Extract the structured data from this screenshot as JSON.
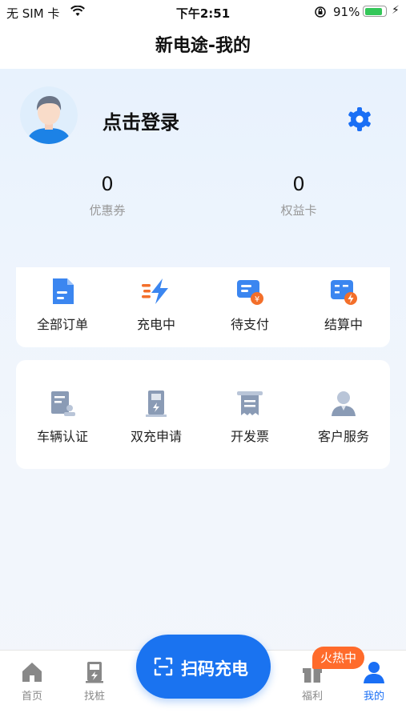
{
  "status_bar": {
    "carrier": "无 SIM 卡",
    "time": "下午2:51",
    "battery_percent": "91%",
    "battery_level": 0.91
  },
  "nav": {
    "title": "新电途-我的"
  },
  "profile": {
    "login_label": "点击登录",
    "stats": [
      {
        "value": "0",
        "label": "优惠券"
      },
      {
        "value": "0",
        "label": "权益卡"
      }
    ]
  },
  "orders": [
    {
      "label": "全部订单",
      "icon": "document-icon"
    },
    {
      "label": "充电中",
      "icon": "charging-bolt-icon"
    },
    {
      "label": "待支付",
      "icon": "wallet-yen-icon"
    },
    {
      "label": "结算中",
      "icon": "calculator-icon"
    }
  ],
  "services": [
    {
      "label": "车辆认证",
      "icon": "vehicle-cert-icon"
    },
    {
      "label": "双充申请",
      "icon": "dual-charger-icon"
    },
    {
      "label": "开发票",
      "icon": "invoice-icon"
    },
    {
      "label": "客户服务",
      "icon": "customer-service-icon"
    }
  ],
  "tab_bar": {
    "tabs": [
      {
        "label": "首页",
        "icon": "home-icon"
      },
      {
        "label": "找桩",
        "icon": "charger-pile-icon"
      },
      {
        "label": "福利",
        "icon": "gift-icon"
      },
      {
        "label": "我的",
        "icon": "user-icon"
      }
    ],
    "scan_button": "扫码充电",
    "hot_badge": "火热中"
  },
  "colors": {
    "accent": "#1a73f0",
    "badge": "#ff6b2b",
    "icon_orange": "#f36f2a"
  }
}
